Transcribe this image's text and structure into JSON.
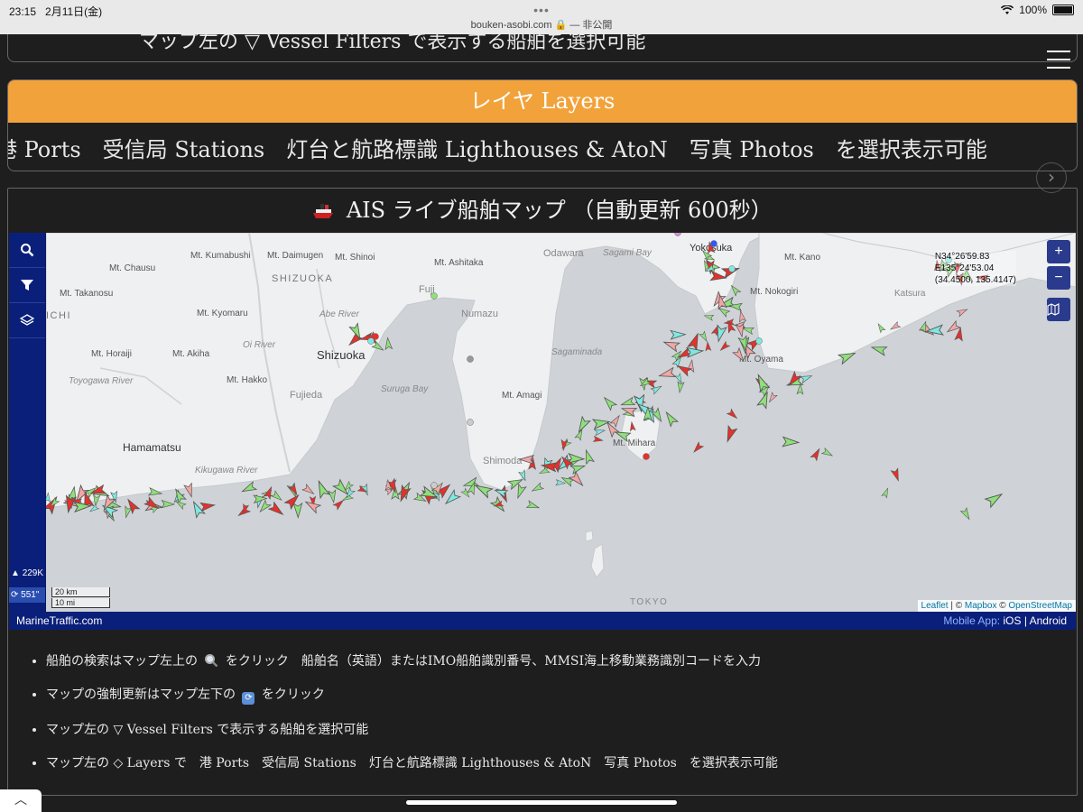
{
  "status_bar": {
    "time": "23:15",
    "date": "2月11日(金)",
    "url": "bouken-asobi.com 🔒 — 非公開",
    "battery": "100%",
    "dots": "•••"
  },
  "top_strip": {
    "text": "マップ左の ▽ Vessel Filters で表示する船舶を選択可能"
  },
  "layers": {
    "heading": "レイヤ Layers",
    "body": "港 Ports　受信局 Stations　灯台と航路標識 Lighthouses & AtoN　写真 Photos　を選択表示可能"
  },
  "map_section": {
    "title": "AIS ライブ船舶マップ （自動更新 600秒）",
    "sidebar": {
      "vessel_count": "229K",
      "refresh_seconds": "551\""
    },
    "zoom_in": "+",
    "zoom_out": "−",
    "coords": {
      "lat": "N34°26'59.83",
      "lon": "E135°24'53.04",
      "decimal": "(34.4500, 135.4147)"
    },
    "scale": {
      "km": "20 km",
      "mi": "10 mi"
    },
    "attribution": {
      "leaflet": "Leaflet",
      "sep1": " | © ",
      "mapbox": "Mapbox",
      "sep2": " © ",
      "osm": "OpenStreetMap"
    },
    "footer": {
      "brand": "MarineTraffic.com",
      "mobile_label": "Mobile App:",
      "ios": "iOS",
      "sep": "|",
      "android": "Android"
    },
    "place_labels": [
      {
        "text": "Mt. Kumabushi"
      },
      {
        "text": "Mt. Daimugen"
      },
      {
        "text": "Mt. Shinoi"
      },
      {
        "text": "Mt. Ashitaka"
      },
      {
        "text": "Odawara"
      },
      {
        "text": "Sagami Bay"
      },
      {
        "text": "Yokosuka"
      },
      {
        "text": "Mt. Kano"
      },
      {
        "text": "Mt. Chausu"
      },
      {
        "text": "SHIZUOKA"
      },
      {
        "text": "Fuji"
      },
      {
        "text": "Numazu"
      },
      {
        "text": "Mt. Nokogiri"
      },
      {
        "text": "Katsura"
      },
      {
        "text": "Mt. Takanosu"
      },
      {
        "text": "ICHI"
      },
      {
        "text": "Mt. Kyomaru"
      },
      {
        "text": "Abe River"
      },
      {
        "text": "Oi River"
      },
      {
        "text": "Mt. Horaiji"
      },
      {
        "text": "Mt. Akiha"
      },
      {
        "text": "Shizuoka"
      },
      {
        "text": "Sagaminada"
      },
      {
        "text": "Mt. Oyama"
      },
      {
        "text": "Toyogawa River"
      },
      {
        "text": "Mt. Hakko"
      },
      {
        "text": "Fujieda"
      },
      {
        "text": "Suruga Bay"
      },
      {
        "text": "Mt. Amagi"
      },
      {
        "text": "Hamamatsu"
      },
      {
        "text": "Mt. Mihara"
      },
      {
        "text": "Kikugawa River"
      },
      {
        "text": "Shimoda"
      },
      {
        "text": "TOKYO"
      }
    ]
  },
  "bullets": [
    {
      "pre": "船舶の検索はマップ左上の",
      "post": "をクリック　船舶名（英語）またはIMO船舶識別番号、MMSI海上移動業務識別コードを入力"
    },
    {
      "pre": "マップの強制更新はマップ左下の",
      "post": "をクリック"
    },
    {
      "pre": "マップ左の ▽ Vessel Filters で表示する船舶を選択可能",
      "post": ""
    },
    {
      "pre": "マップ左の ◇ Layers で　港 Ports　受信局 Stations　灯台と航路標識 Lighthouses & AtoN　写真 Photos　を選択表示可能",
      "post": ""
    }
  ],
  "colors": {
    "accent_orange": "#f2a23a",
    "map_navy": "#0a1f7a",
    "sea": "#cfd3d7",
    "land": "#eef0f1",
    "ship_green": "#8ee07a",
    "ship_red": "#e8302a",
    "ship_cyan": "#7fe8e0"
  }
}
